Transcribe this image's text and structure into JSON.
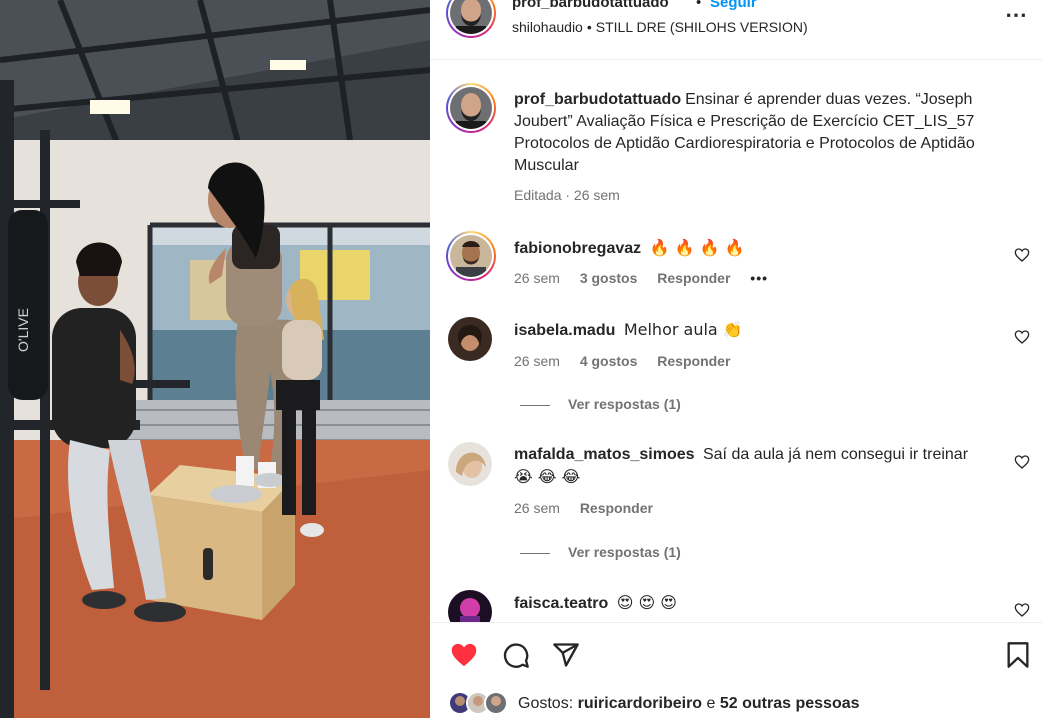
{
  "header": {
    "username": "prof_barbudotattuado",
    "separator": "•",
    "follow_label": "Seguir",
    "audio_artist": "shilohaudio",
    "audio_sep": "•",
    "audio_track": "STILL DRE (SHILOHS VERSION)",
    "more_icon": "more-horizontal-icon"
  },
  "caption": {
    "username": "prof_barbudotattuado",
    "text": "Ensinar é aprender duas vezes. “Joseph Joubert” Avaliação Física e Prescrição de Exercício CET_LIS_57 Protocolos de Aptidão Cardiorespiratoria e Protocolos de Aptidão Muscular",
    "meta": "Editada · 26 sem"
  },
  "comments": [
    {
      "username": "fabionobregavaz",
      "text": "🔥 🔥 🔥 🔥",
      "time": "26 sem",
      "likes": "3 gostos",
      "reply": "Responder",
      "more": "•••"
    },
    {
      "username": "isabela.madu",
      "text": "Melhor aula 👏",
      "time": "26 sem",
      "likes": "4 gostos",
      "reply": "Responder",
      "view_replies": "Ver respostas (1)"
    },
    {
      "username": "mafalda_matos_simoes",
      "text": "Saí da aula já nem consegui ir treinar",
      "emojis": "😭 😂 😂",
      "time": "26 sem",
      "reply": "Responder",
      "view_replies": "Ver respostas (1)"
    },
    {
      "username": "faisca.teatro",
      "text": "😍 😍 😍"
    }
  ],
  "actions": {
    "like_icon": "heart-filled-icon",
    "comment_icon": "comment-icon",
    "share_icon": "share-icon",
    "save_icon": "bookmark-icon",
    "like_color": "#ff3040"
  },
  "likes": {
    "prefix": "Gostos:",
    "user": "ruiricardoribeiro",
    "connector": "e",
    "others": "52 outras pessoas"
  }
}
